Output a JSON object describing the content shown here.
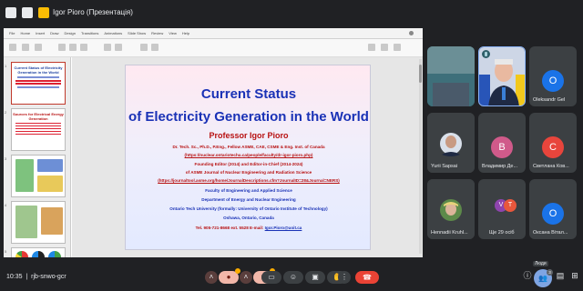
{
  "top_bar": {
    "presenter_label": "Igor Pioro (Презентація)"
  },
  "presentation": {
    "ppt_tabs": [
      "File",
      "Home",
      "Insert",
      "Draw",
      "Design",
      "Transitions",
      "Animations",
      "Slide Show",
      "Review",
      "View",
      "Help"
    ],
    "thumbnails": [
      {
        "number": "1",
        "title": "Current Status of Electricity Generation in the World"
      },
      {
        "number": "2",
        "title": "Sources for Electrical Energy Generation"
      },
      {
        "number": "3",
        "title": ""
      },
      {
        "number": "4",
        "title": ""
      },
      {
        "number": "5",
        "title": ""
      }
    ],
    "slide": {
      "title_line1": "Current Status",
      "title_line2": "of Electricity Generation in the World",
      "author": "Professor Igor Pioro",
      "lines": [
        {
          "text": "Dr. Tech. Sc., Ph.D., P.Eng., Fellow ASME, CAE, CSME & Eng. Inst. of Canada",
          "color": "red"
        },
        {
          "text": "(https://nuclear.ontariotechu.ca/people/faculty/dr-igor-pioro.php)",
          "color": "red",
          "underline": true
        },
        {
          "text": "Founding Editor (2014) and Editor-in-Chief (2014-2024)",
          "color": "red"
        },
        {
          "text": "of ASME Journal of Nuclear Engineering and Radiation Science",
          "color": "red"
        },
        {
          "text": "(https://journaltool.asme.org/home/JournalDescriptions.cfm?JournalID=28&Journal=NERS)",
          "color": "red",
          "underline": true
        },
        {
          "text": "Faculty of Engineering and Applied Science",
          "color": "blue"
        },
        {
          "text": "Department of Energy and Nuclear Engineering",
          "color": "blue"
        },
        {
          "text": "Ontario Tech University (formally: University of Ontario Institute of Technology)",
          "color": "blue"
        },
        {
          "text": "Oshawa, Ontario, Canada",
          "color": "blue"
        }
      ],
      "contact_prefix": "Tel. 905-721-8668 ext. 5528 E-mail: ",
      "contact_email": "Igor.Pioro@uoit.ca"
    }
  },
  "participants": [
    {
      "name": "Oleksandr Gel",
      "avatar": "O",
      "avatar_color": "#1a73e8",
      "tile": "dark"
    },
    {
      "name": "Yurii Sapsai",
      "avatar": "",
      "tile": "photo"
    },
    {
      "name": "Владимир Де...",
      "avatar": "B",
      "avatar_color": "#d05a8a",
      "tile": "dark"
    },
    {
      "name": "Светлана Ков...",
      "avatar": "C",
      "avatar_color": "#e8453c",
      "tile": "dark"
    },
    {
      "name": "Hennadii Kruhl...",
      "avatar": "",
      "tile": "photo"
    },
    {
      "name": "Ще 29 осіб",
      "avatar": "",
      "tile": "dark"
    },
    {
      "name": "Оксана Вітал...",
      "avatar": "O",
      "avatar_color": "#1a73e8",
      "tile": "dark"
    }
  ],
  "more_avatars": [
    "V",
    "T"
  ],
  "bottom_bar": {
    "time": "10:35",
    "meeting_code": "rjb-snwo-gcr",
    "people_tooltip": "Люди",
    "people_count": "3"
  },
  "colors": {
    "accent": "#8ab4f8",
    "end_call": "#ea4335",
    "background": "#202124"
  }
}
